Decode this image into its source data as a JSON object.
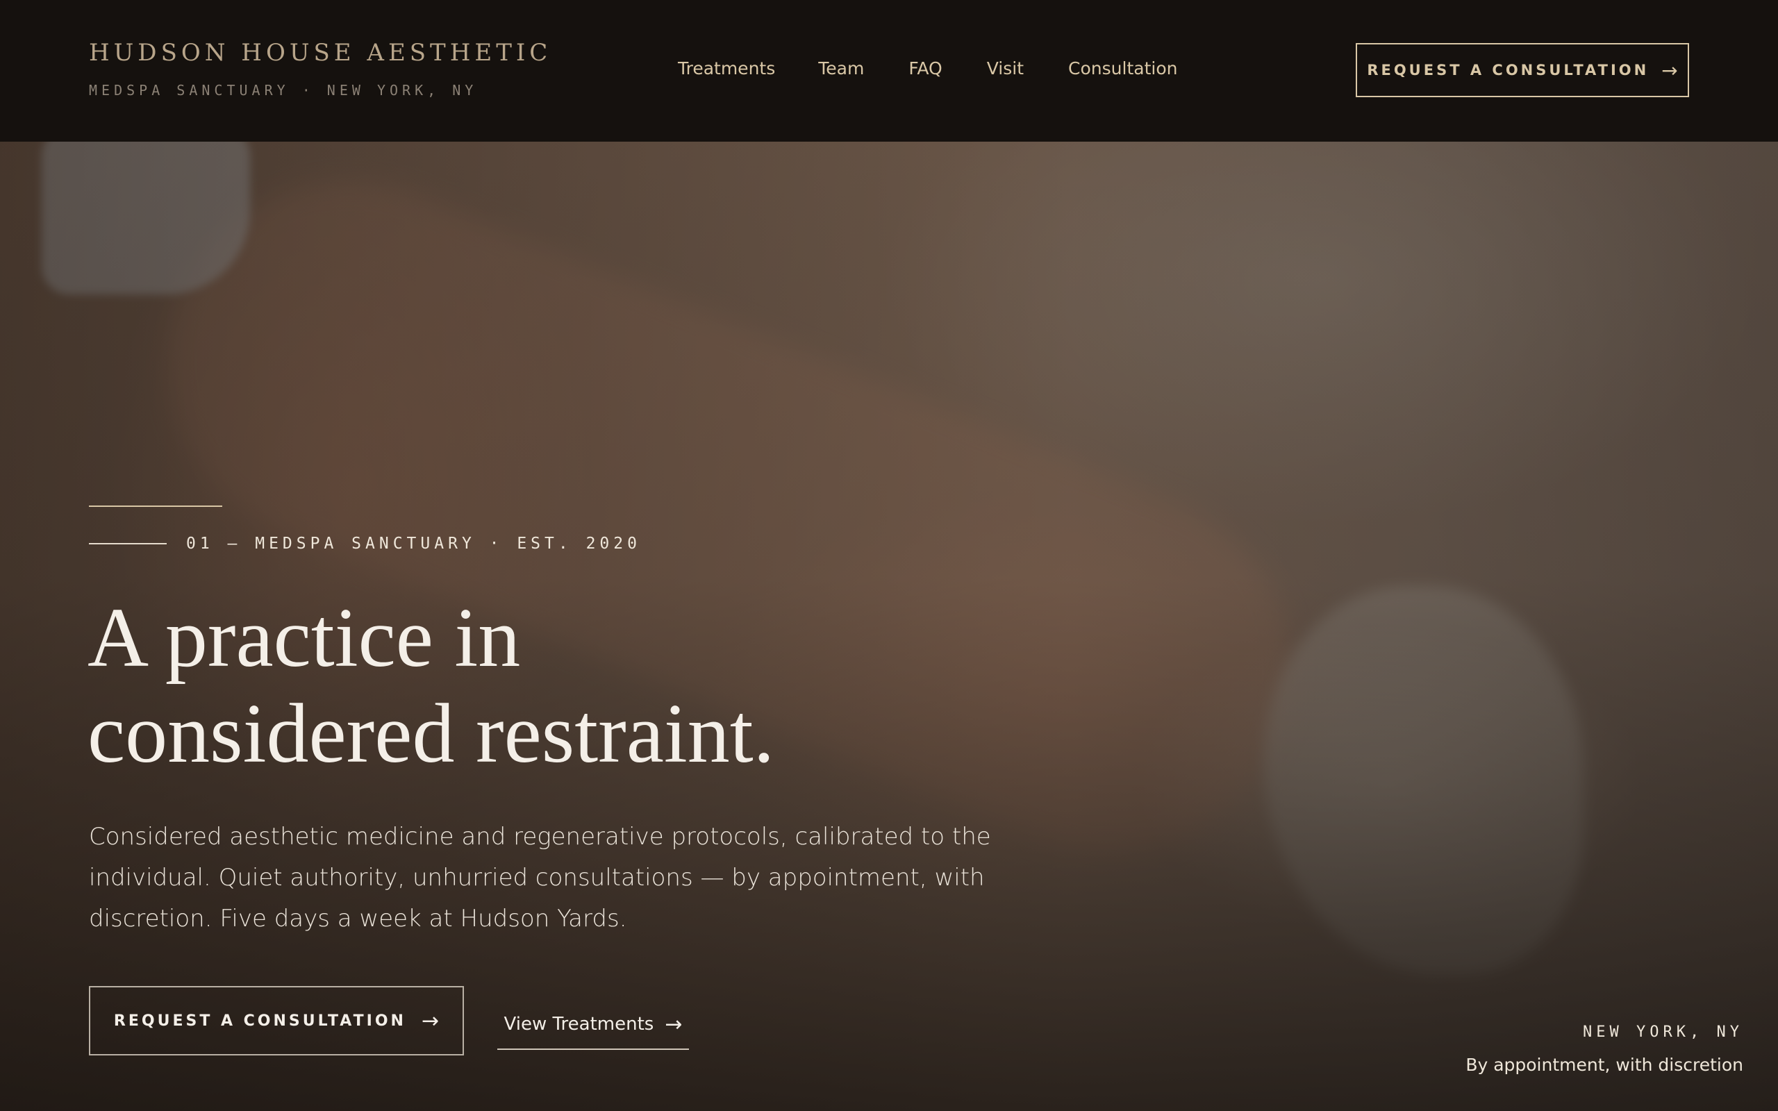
{
  "brand": {
    "name": "HUDSON HOUSE AESTHETIC",
    "tagline": "MEDSPA SANCTUARY · NEW YORK, NY"
  },
  "nav": {
    "items": [
      {
        "label": "Treatments"
      },
      {
        "label": "Team"
      },
      {
        "label": "FAQ"
      },
      {
        "label": "Visit"
      },
      {
        "label": "Consultation"
      }
    ]
  },
  "header": {
    "cta_label": "REQUEST A CONSULTATION",
    "cta_arrow": "→"
  },
  "hero": {
    "eyebrow": "01 — MEDSPA SANCTUARY · EST. 2020",
    "headline_line1": "A practice in",
    "headline_line2": "considered restraint.",
    "intro_line1": "Considered aesthetic medicine and regenerative protocols, calibrated to the",
    "intro_line2": "individual. Quiet authority, unhurried consultations — by appointment, with",
    "intro_line3": "discretion. Five days a week at Hudson Yards.",
    "primary_cta": "REQUEST A CONSULTATION",
    "primary_arrow": "→",
    "secondary_cta": "View Treatments",
    "secondary_arrow": "→",
    "location_city": "NEW YORK, NY",
    "location_note": "By appointment, with discretion"
  },
  "colors": {
    "header_bg": "#15110e",
    "accent_gold": "#d9c7a6",
    "text_light": "#f4efe8"
  }
}
